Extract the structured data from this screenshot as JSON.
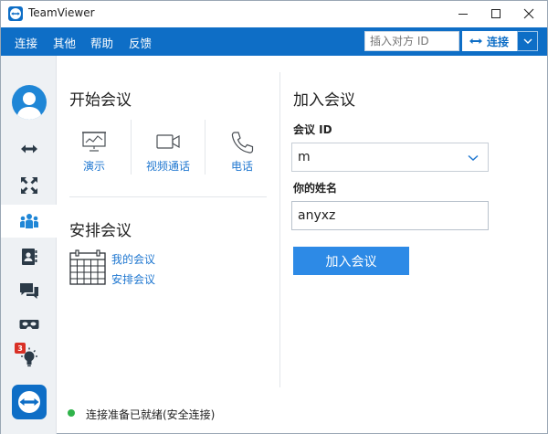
{
  "window": {
    "title": "TeamViewer"
  },
  "menu": {
    "items": [
      "连接",
      "其他",
      "帮助",
      "反馈"
    ]
  },
  "partner": {
    "placeholder": "插入对方 ID",
    "connect_label": "连接"
  },
  "start_meeting": {
    "title": "开始会议",
    "tiles": [
      {
        "label": "演示",
        "icon": "presentation-icon"
      },
      {
        "label": "视频通话",
        "icon": "video-camera-icon"
      },
      {
        "label": "电话",
        "icon": "phone-icon"
      }
    ]
  },
  "schedule_meeting": {
    "title": "安排会议",
    "links": [
      "我的会议",
      "安排会议"
    ]
  },
  "join_meeting": {
    "title": "加入会议",
    "id_label": "会议 ID",
    "id_value": "m",
    "name_label": "你的姓名",
    "name_value": "anyxz",
    "button": "加入会议"
  },
  "sidebar": {
    "notification_count": "3",
    "items": [
      "remote-control-icon",
      "remote-meeting-icon",
      "meeting-icon",
      "contacts-icon",
      "chat-icon",
      "augmented-reality-icon",
      "getting-started-icon"
    ]
  },
  "status": {
    "text": "连接准备已就绪(安全连接)",
    "color": "#2fb34a"
  },
  "colors": {
    "brand": "#0e6ec6",
    "link": "#1f77d0",
    "button": "#2d8ae6"
  }
}
